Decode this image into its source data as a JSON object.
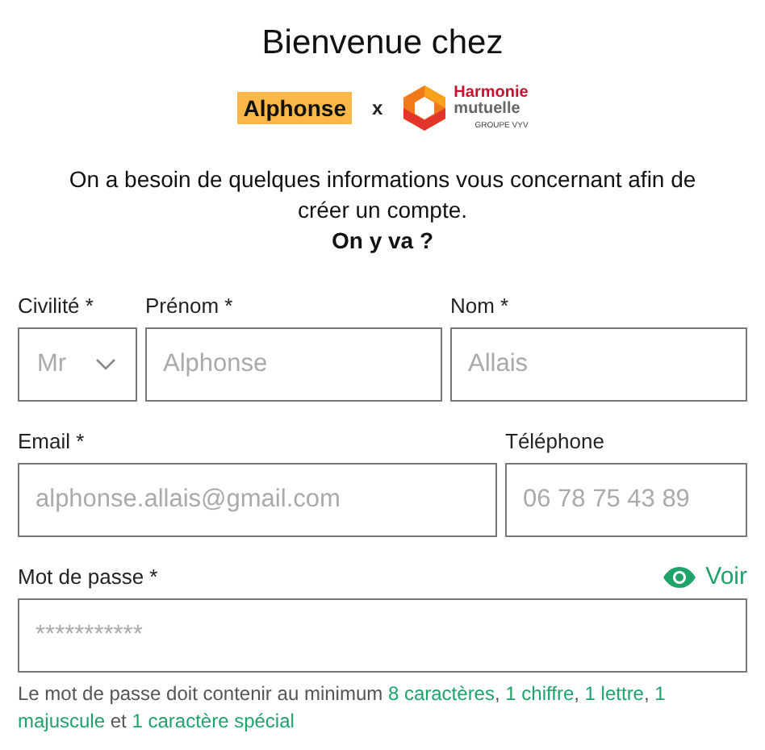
{
  "title": "Bienvenue chez",
  "partners": {
    "left": "Alphonse",
    "separator": "x",
    "right_line1": "Harmonie",
    "right_line2": "mutuelle",
    "right_line3": "GROUPE VYV"
  },
  "intro": "On a besoin de quelques informations vous concernant afin de créer un compte.",
  "intro_cta": "On y va ?",
  "rows": [
    [
      {
        "kind": "select",
        "label": "Civilité *",
        "value": "Mr"
      },
      {
        "kind": "input",
        "label": "Prénom *",
        "placeholder": "Alphonse"
      },
      {
        "kind": "input",
        "label": "Nom *",
        "placeholder": "Allais"
      }
    ],
    [
      {
        "kind": "input",
        "label": "Email *",
        "placeholder": "alphonse.allais@gmail.com"
      },
      {
        "kind": "input",
        "label": "Téléphone",
        "placeholder": "06 78 75 43 89"
      }
    ],
    [
      {
        "kind": "password",
        "label": "Mot de passe *",
        "placeholder": "***********",
        "toggle": "Voir"
      }
    ]
  ],
  "hint": [
    {
      "text": "Le mot de passe doit contenir au minimum ",
      "highlight": false
    },
    {
      "text": "8 caractères",
      "highlight": true
    },
    {
      "text": ", ",
      "highlight": false
    },
    {
      "text": "1 chiffre",
      "highlight": true
    },
    {
      "text": ", ",
      "highlight": false
    },
    {
      "text": "1 lettre",
      "highlight": true
    },
    {
      "text": ", ",
      "highlight": false
    },
    {
      "text": "1 majuscule",
      "highlight": true
    },
    {
      "text": " et ",
      "highlight": false
    },
    {
      "text": "1 caractère spécial",
      "highlight": true
    }
  ]
}
